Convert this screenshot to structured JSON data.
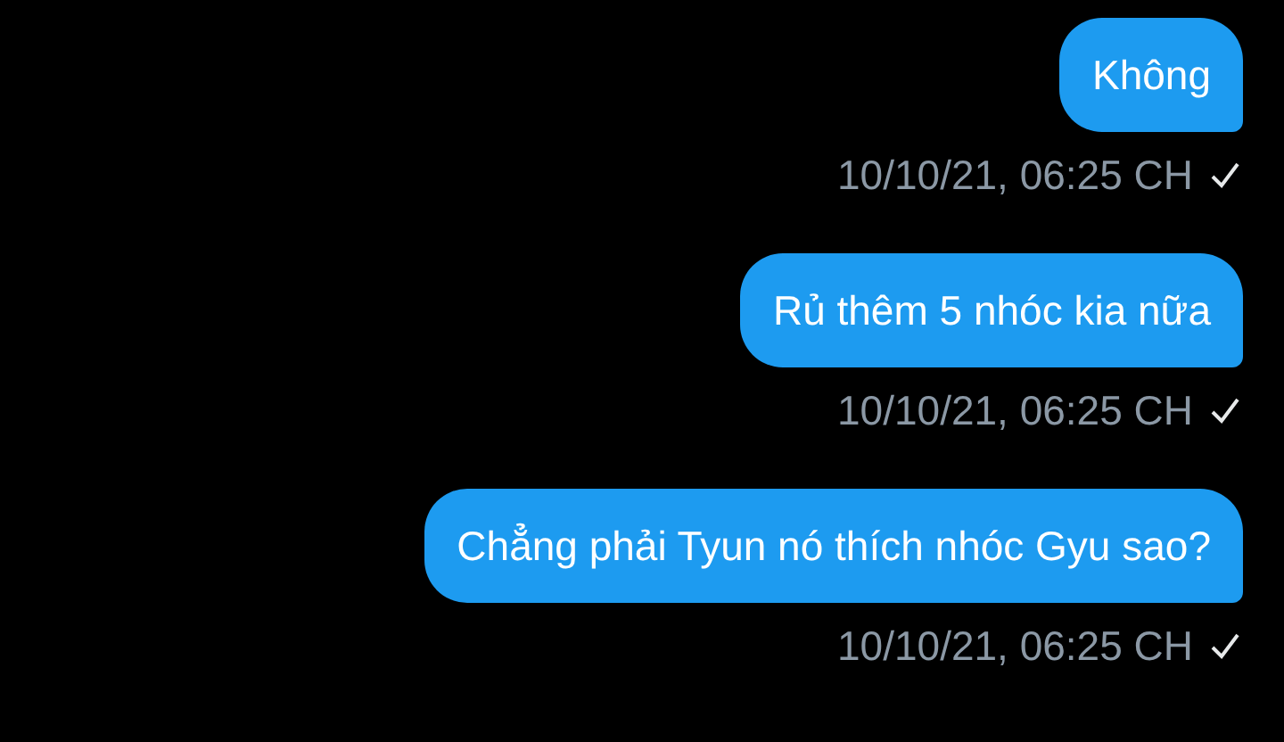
{
  "messages": [
    {
      "text": "Không",
      "time": "10/10/21, 06:25 CH",
      "sent": true
    },
    {
      "text": "Rủ thêm 5 nhóc kia nữa",
      "time": "10/10/21, 06:25 CH",
      "sent": true
    },
    {
      "text": "Chẳng phải Tyun nó thích nhóc Gyu sao?",
      "time": "10/10/21, 06:25 CH",
      "sent": true
    }
  ]
}
